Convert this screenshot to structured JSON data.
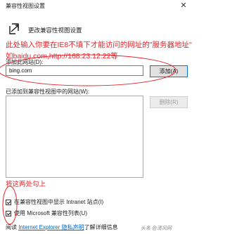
{
  "window": {
    "title": "兼容性视图设置",
    "close_glyph": "✕"
  },
  "header": {
    "title": "更改兼容性视图设置"
  },
  "annotations": {
    "note_line1": "此处输入你要在IE8不填下才能访问的网址的\"服务器地址\"",
    "note_line2": "如baidu.com,http://168.23.12.22等",
    "note_bottom": "将这两处勾上",
    "color": "#e5262c"
  },
  "add_site": {
    "label": "添加此网站(D):",
    "value": "bing.com",
    "button": "添加(A)"
  },
  "added_sites": {
    "label": "已添加到兼容性视图中的网站(W):",
    "items": [],
    "remove_button": "删除(R)"
  },
  "options": {
    "intranet": {
      "label": "在兼容性视图中显示 Intranet 站点(I)",
      "checked": true
    },
    "ms_list": {
      "label": "使用 Microsoft 兼容性列表(U)",
      "checked": true
    }
  },
  "footer": {
    "prefix": "阅读",
    "link_text": "Internet Explorer 隐私声明",
    "suffix": "了解详细信息"
  },
  "watermark": "头条 @清风网"
}
